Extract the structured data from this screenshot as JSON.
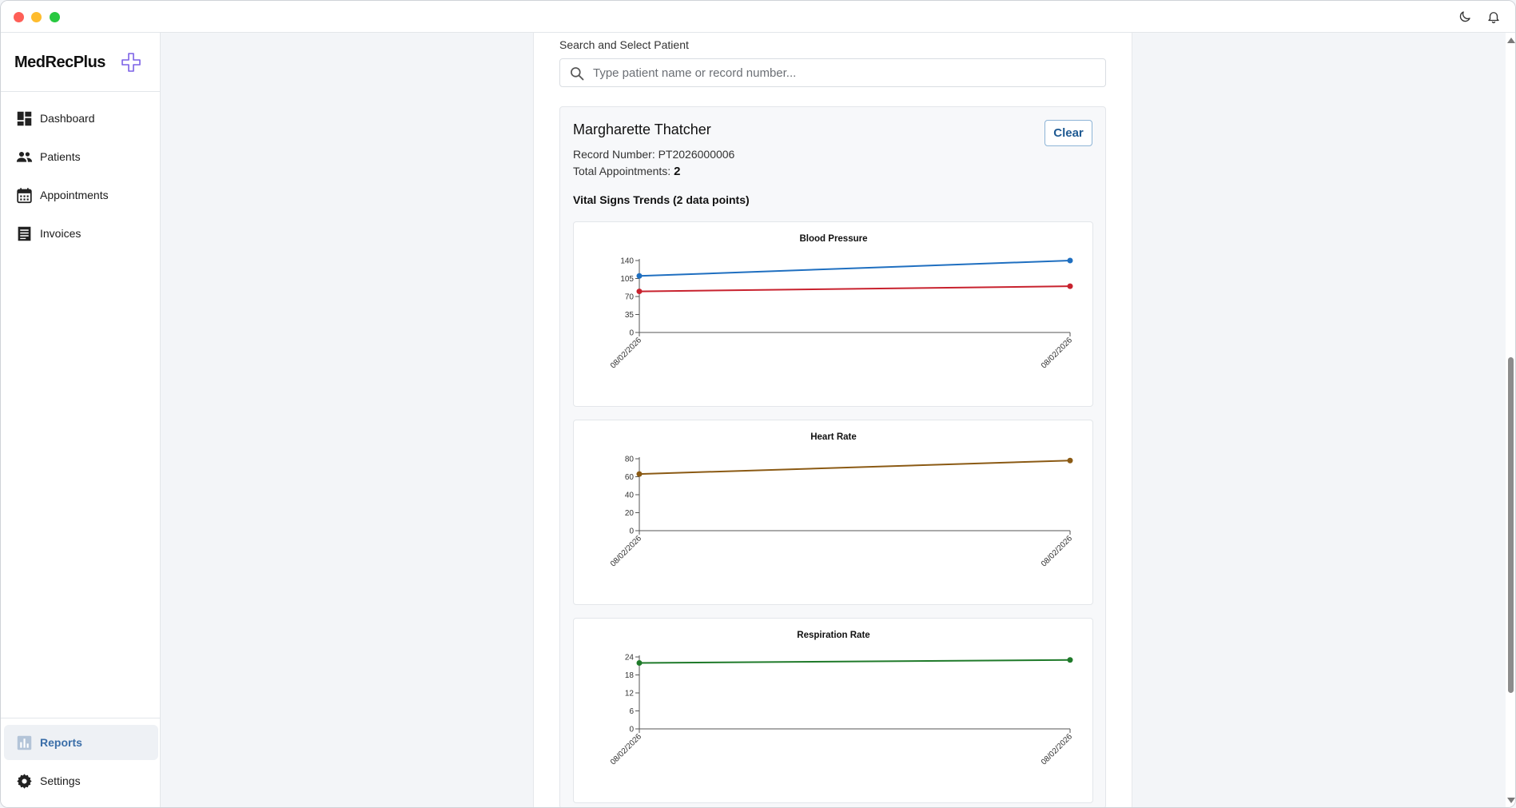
{
  "app": {
    "name": "MedRecPlus"
  },
  "sidebar": {
    "items": [
      {
        "label": "Dashboard",
        "icon": "dashboard-icon"
      },
      {
        "label": "Patients",
        "icon": "people-icon"
      },
      {
        "label": "Appointments",
        "icon": "calendar-icon"
      },
      {
        "label": "Invoices",
        "icon": "receipt-icon"
      }
    ],
    "bottom_items": [
      {
        "label": "Reports",
        "icon": "bar-chart-icon",
        "active": true
      },
      {
        "label": "Settings",
        "icon": "gear-icon"
      }
    ]
  },
  "search": {
    "label": "Search and Select Patient",
    "placeholder": "Type patient name or record number..."
  },
  "patient": {
    "name": "Margharette Thatcher",
    "clear_label": "Clear",
    "record_label": "Record Number:",
    "record_number": "PT2026000006",
    "appointments_label": "Total Appointments:",
    "appointments_count": "2"
  },
  "vitals": {
    "section_title": "Vital Signs Trends (2 data points)"
  },
  "colors": {
    "systolic": "#1f6fc0",
    "diastolic": "#c8222e",
    "heart_rate": "#8b5a14",
    "respiration": "#1f7a2a",
    "accent": "#3a6ea8"
  },
  "chart_data": [
    {
      "type": "line",
      "title": "Blood Pressure",
      "x": [
        "08/02/2026",
        "08/02/2026"
      ],
      "series": [
        {
          "values": [
            110,
            140
          ],
          "color": "#1f6fc0"
        },
        {
          "values": [
            80,
            90
          ],
          "color": "#c8222e"
        }
      ],
      "yticks": [
        0,
        35,
        70,
        105,
        140
      ],
      "ylim": [
        0,
        140
      ],
      "grid": false
    },
    {
      "type": "line",
      "title": "Heart Rate",
      "x": [
        "08/02/2026",
        "08/02/2026"
      ],
      "series": [
        {
          "values": [
            63,
            78
          ],
          "color": "#8b5a14"
        }
      ],
      "yticks": [
        0,
        20,
        40,
        60,
        80
      ],
      "ylim": [
        0,
        80
      ],
      "grid": false
    },
    {
      "type": "line",
      "title": "Respiration Rate",
      "x": [
        "08/02/2026",
        "08/02/2026"
      ],
      "series": [
        {
          "values": [
            22,
            23
          ],
          "color": "#1f7a2a"
        }
      ],
      "yticks": [
        0,
        6,
        12,
        18,
        24
      ],
      "ylim": [
        0,
        24
      ],
      "grid": false
    }
  ]
}
